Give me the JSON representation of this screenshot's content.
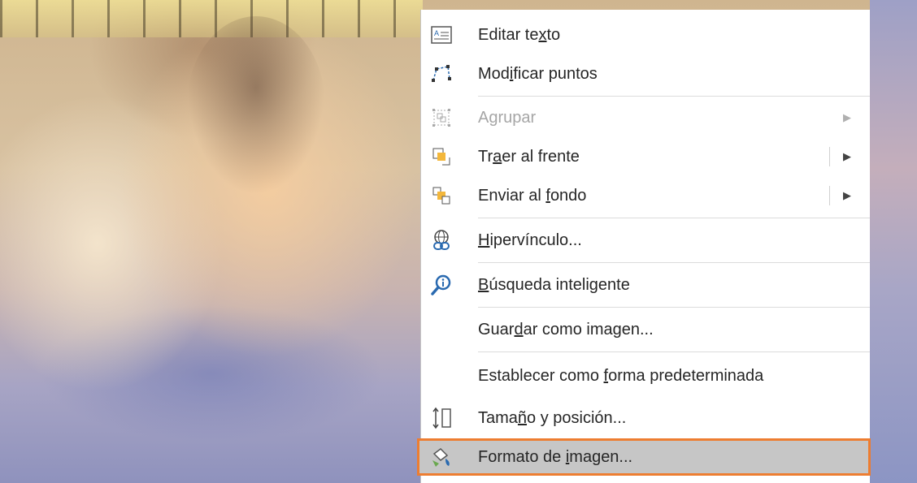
{
  "menu": {
    "items": [
      {
        "pre": "Editar te",
        "u": "x",
        "post": "to",
        "icon": "edit-text-icon"
      },
      {
        "pre": "Mod",
        "u": "i",
        "post": "ficar puntos",
        "icon": "edit-points-icon"
      },
      {
        "pre": "A",
        "u": "g",
        "post": "rupar",
        "icon": "group-icon",
        "disabled": true,
        "submenu": true
      },
      {
        "pre": "Tr",
        "u": "a",
        "post": "er al frente",
        "icon": "bring-to-front-icon",
        "submenu": true
      },
      {
        "pre": "Enviar al ",
        "u": "f",
        "post": "ondo",
        "icon": "send-to-back-icon",
        "submenu": true
      },
      {
        "pre": "",
        "u": "H",
        "post": "ipervínculo...",
        "icon": "hyperlink-icon"
      },
      {
        "pre": "",
        "u": "B",
        "post": "úsqueda inteligente",
        "icon": "smart-lookup-icon"
      },
      {
        "pre": "Guar",
        "u": "d",
        "post": "ar como imagen..."
      },
      {
        "pre": "Establecer como ",
        "u": "f",
        "post": "orma predeterminada"
      },
      {
        "pre": "Tama",
        "u": "ñ",
        "post": "o y posición...",
        "icon": "size-position-icon"
      },
      {
        "pre": "Formato de ",
        "u": "i",
        "post": "magen...",
        "icon": "format-picture-icon",
        "highlighted": true
      }
    ],
    "submenu_arrow": "▶",
    "colors": {
      "highlight": "#c6c6c6",
      "highlight_border": "#ed7d31"
    }
  }
}
